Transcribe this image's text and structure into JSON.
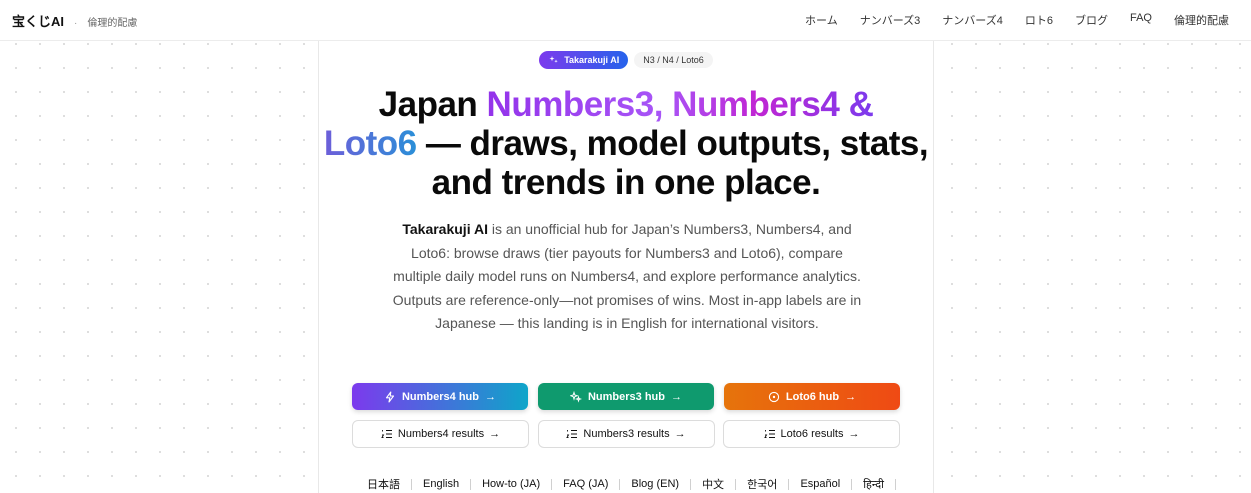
{
  "header": {
    "brand": "宝くじAI",
    "separator": "·",
    "subtitle": "倫理的配慮",
    "nav": [
      "ホーム",
      "ナンバーズ3",
      "ナンバーズ4",
      "ロト6",
      "ブログ",
      "FAQ",
      "倫理的配慮"
    ]
  },
  "hero": {
    "chip_brand": "Takarakuji AI",
    "chip_tag": "N3 / N4 / Loto6",
    "title_part1": "Japan ",
    "title_grad1": "Numbers3, Numbers4 &",
    "title_grad2": "Loto6",
    "title_part2": " — draws, model outputs, stats, and trends in one place.",
    "lead_brand": "Takarakuji AI",
    "lead_text": " is an unofficial hub for Japan’s Numbers3, Numbers4, and Loto6: browse draws (tier payouts for Numbers3 and Loto6), compare multiple daily model runs on Numbers4, and explore performance analytics. Outputs are reference-only—not promises of wins. Most in-app labels are in Japanese — this landing is in English for international visitors."
  },
  "buttons": {
    "primary": [
      {
        "label": "Numbers4 hub",
        "icon": "zap-icon"
      },
      {
        "label": "Numbers3 hub",
        "icon": "sparkles-icon"
      },
      {
        "label": "Loto6 hub",
        "icon": "circle-target-icon"
      }
    ],
    "secondary": [
      {
        "label": "Numbers4 results",
        "icon": "list-icon"
      },
      {
        "label": "Numbers3 results",
        "icon": "list-icon"
      },
      {
        "label": "Loto6 results",
        "icon": "list-icon"
      }
    ],
    "arrow": "→"
  },
  "languages": [
    "日本語",
    "English",
    "How-to (JA)",
    "FAQ (JA)",
    "Blog (EN)",
    "中文",
    "한국어",
    "Español",
    "हिन्दी"
  ],
  "colors": {
    "n4": "#7c3aed",
    "n3": "#0f9a6e",
    "l6": "#ef4a14"
  }
}
